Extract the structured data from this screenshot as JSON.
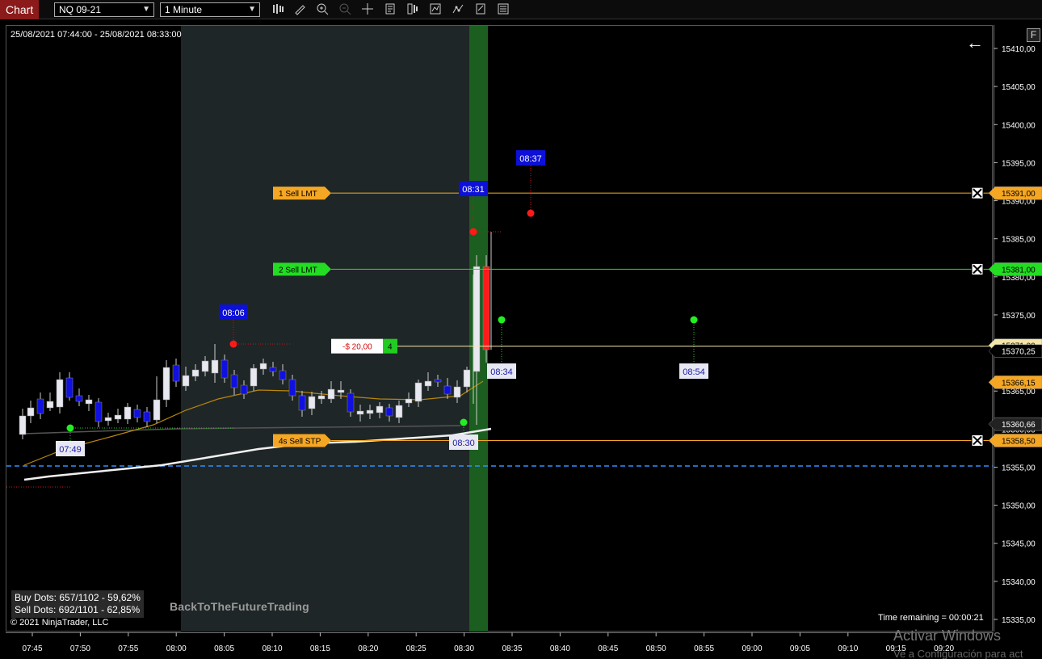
{
  "toolbar": {
    "tab_label": "Chart",
    "instrument": "NQ 09-21",
    "interval": "1 Minute",
    "icons": [
      "bar-type-icon",
      "drawing-tool-icon",
      "zoom-in-icon",
      "zoom-out-icon",
      "crosshair-icon",
      "properties-icon",
      "data-series-icon",
      "indicators-icon",
      "strategies-icon",
      "templates-icon",
      "chart-trader-icon"
    ]
  },
  "chart": {
    "date_range": "25/08/2021 07:44:00 - 25/08/2021 08:33:00",
    "buy_dots": "Buy Dots: 657/1102 - 59,62%",
    "sell_dots": "Sell Dots: 692/1101 - 62,85%",
    "copyright": "© 2021 NinjaTrader, LLC",
    "watermark": "BackToTheFutureTrading",
    "time_remaining": "Time remaining = 00:00:21",
    "f_button": "F",
    "activate_title": "Activar Windows",
    "activate_sub": "Ve a Configuración para act"
  },
  "price_axis": {
    "ticks": [
      {
        "price": 15410,
        "label": "15410,00"
      },
      {
        "price": 15405,
        "label": "15405,00"
      },
      {
        "price": 15400,
        "label": "15400,00"
      },
      {
        "price": 15395,
        "label": "15395,00"
      },
      {
        "price": 15390,
        "label": "15390,00"
      },
      {
        "price": 15385,
        "label": "15385,00"
      },
      {
        "price": 15380,
        "label": "15380,00"
      },
      {
        "price": 15375,
        "label": "15375,00"
      },
      {
        "price": 15370,
        "label": "15370,00"
      },
      {
        "price": 15365,
        "label": "15365,00"
      },
      {
        "price": 15360,
        "label": "15360,00"
      },
      {
        "price": 15355,
        "label": "15355,00"
      },
      {
        "price": 15350,
        "label": "15350,00"
      },
      {
        "price": 15345,
        "label": "15345,00"
      },
      {
        "price": 15340,
        "label": "15340,00"
      },
      {
        "price": 15335,
        "label": "15335,00"
      }
    ],
    "markers": [
      {
        "price": 15391.0,
        "label": "15391,00",
        "color": "#f5a623",
        "text_color": "#000"
      },
      {
        "price": 15381.0,
        "label": "15381,00",
        "color": "#22dd22",
        "text_color": "#000"
      },
      {
        "price": 15371.0,
        "label": "15371,00",
        "color": "#f5e6a8",
        "text_color": "#000"
      },
      {
        "price": 15370.25,
        "label": "15370,25",
        "color": "#000",
        "text_color": "#fff"
      },
      {
        "price": 15366.15,
        "label": "15366,15",
        "color": "#f5a623",
        "text_color": "#000"
      },
      {
        "price": 15360.66,
        "label": "15360,66",
        "color": "#222",
        "text_color": "#fff"
      },
      {
        "price": 15358.5,
        "label": "15358,50",
        "color": "#f5a623",
        "text_color": "#000"
      }
    ]
  },
  "time_axis": {
    "ticks": [
      "07:45",
      "07:50",
      "07:55",
      "08:00",
      "08:05",
      "08:10",
      "08:15",
      "08:20",
      "08:25",
      "08:30",
      "08:35",
      "08:40",
      "08:45",
      "08:50",
      "08:55",
      "09:00",
      "09:05",
      "09:10",
      "09:15",
      "09:20"
    ]
  },
  "orders": [
    {
      "qty": "1",
      "label": "Sell LMT",
      "price": 15391.0,
      "color": "#f5a623"
    },
    {
      "qty": "2",
      "label": "Sell LMT",
      "price": 15381.0,
      "color": "#22dd22"
    },
    {
      "qty": "4s",
      "label": "Sell STP",
      "price": 15358.5,
      "color": "#f5a623"
    }
  ],
  "position": {
    "pnl": "-$ 20,00",
    "qty": "4",
    "price": 15371.0
  },
  "time_labels": [
    {
      "text": "08:37",
      "style": "blue"
    },
    {
      "text": "08:31",
      "style": "blue"
    },
    {
      "text": "08:06",
      "style": "blue"
    },
    {
      "text": "08:34",
      "style": "white"
    },
    {
      "text": "08:54",
      "style": "white"
    },
    {
      "text": "07:49",
      "style": "white"
    },
    {
      "text": "08:30",
      "style": "white"
    }
  ],
  "colors": {
    "background": "#000000",
    "session_shade": "#1f2627",
    "current_bar_highlight": "#1b5e20",
    "up_candle": "#e8e8f0",
    "down_candle": "#1010e0",
    "last_down_candle": "#ff1a1a",
    "sell_dot": "#ff1a1a",
    "buy_dot": "#22ee22",
    "dashed_line": "#2f8fff"
  }
}
